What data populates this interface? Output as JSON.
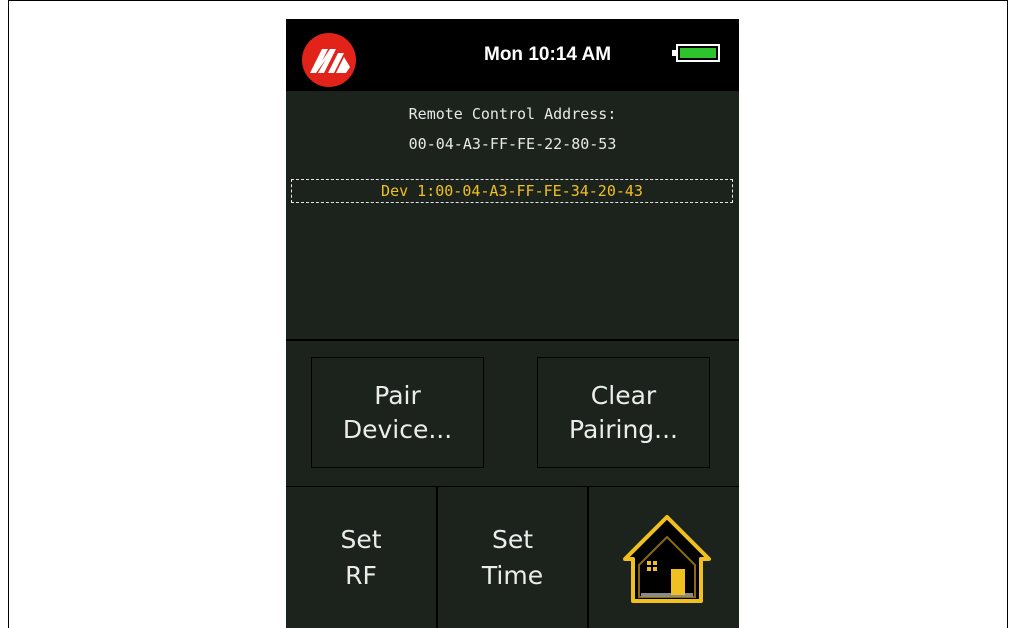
{
  "status_bar": {
    "clock": "Mon 10:14 AM",
    "battery_level": 1.0
  },
  "remote": {
    "label": "Remote Control Address:",
    "address": "00-04-A3-FF-FE-22-80-53"
  },
  "paired_devices": [
    "Dev 1:00-04-A3-FF-FE-34-20-43"
  ],
  "actions": {
    "pair": [
      "Pair",
      "Device..."
    ],
    "clear": [
      "Clear",
      "Pairing..."
    ]
  },
  "nav": {
    "set_rf": [
      "Set",
      "RF"
    ],
    "set_time": [
      "Set",
      "Time"
    ],
    "home_icon": "home-icon"
  },
  "colors": {
    "logo": "#e2231a",
    "battery": "#2fc22f",
    "selected_text": "#f0c020",
    "home": "#f0c020"
  }
}
